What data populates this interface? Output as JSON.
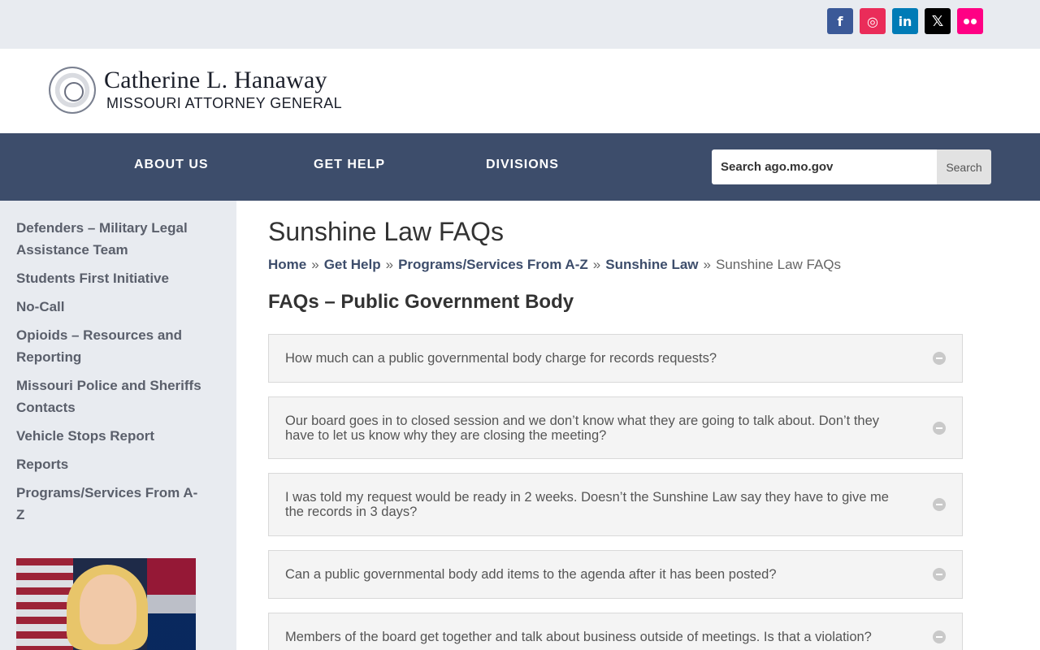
{
  "social": {
    "facebook": "f",
    "instagram": "◎",
    "linkedin": "in",
    "x": "𝕏"
  },
  "header": {
    "name": "Catherine L. Hanaway",
    "subtitle": "MISSOURI ATTORNEY GENERAL"
  },
  "nav": {
    "items": [
      {
        "label": "ABOUT US"
      },
      {
        "label": "GET HELP"
      },
      {
        "label": "DIVISIONS"
      }
    ],
    "search": {
      "placeholder": "Search ago.mo.gov",
      "button": "Search"
    }
  },
  "sidebar": {
    "items": [
      {
        "label": "Defenders – Military Legal Assistance Team"
      },
      {
        "label": "Students First Initiative"
      },
      {
        "label": "No-Call"
      },
      {
        "label": "Opioids – Resources and Reporting"
      },
      {
        "label": "Missouri Police and Sheriffs Contacts"
      },
      {
        "label": "Vehicle Stops Report"
      },
      {
        "label": "Reports"
      },
      {
        "label": "Programs/Services From A-Z"
      }
    ]
  },
  "main": {
    "title": "Sunshine Law FAQs",
    "breadcrumb": {
      "items": [
        "Home",
        "Get Help",
        "Programs/Services From A-Z",
        "Sunshine Law"
      ],
      "separator": "»",
      "current": "Sunshine Law FAQs"
    },
    "section_title": "FAQs – Public Government Body",
    "faqs": [
      {
        "question": "How much can a public governmental body charge for records requests?"
      },
      {
        "question": "Our board goes in to closed session and we don’t know what they are going to talk about. Don’t they have to let us know why they are closing the meeting?"
      },
      {
        "question": "I was told my request would be ready in 2 weeks. Doesn’t the Sunshine Law say they have to give me the records in 3 days?"
      },
      {
        "question": "Can a public governmental body add items to the agenda after it has been posted?"
      },
      {
        "question": "Members of the board get together and talk about business outside of meetings. Is that a violation?"
      }
    ]
  },
  "colors": {
    "nav_bg": "#3d4d6b",
    "topbar_bg": "#e8ebf0",
    "link": "#3d4d6b"
  }
}
